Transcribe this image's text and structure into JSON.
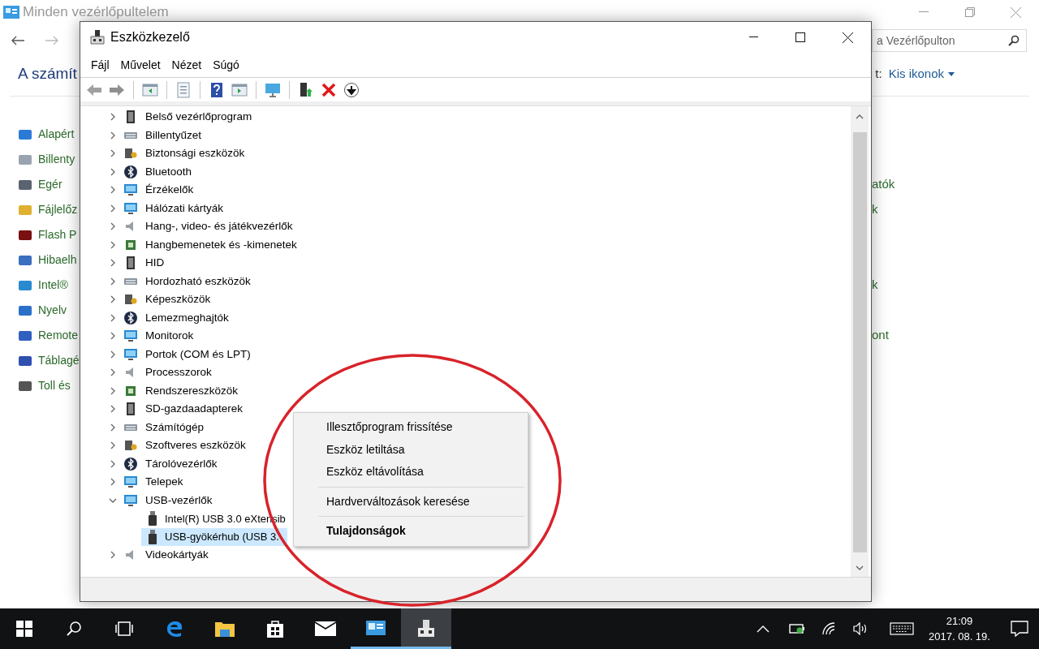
{
  "background_window": {
    "title": "Minden vezérlőpultelem",
    "search": {
      "placeholder": "a Vezérlőpulton"
    },
    "heading": "A számít",
    "view_label": "t:",
    "view_value": "Kis ikonok",
    "rows": [
      {
        "left": "Alapért"
      },
      {
        "left": "Billenty"
      },
      {
        "left": "Egér",
        "right": "atók"
      },
      {
        "left": "Fájlelőz",
        "right": "k"
      },
      {
        "left": "Flash P"
      },
      {
        "left": "Hibaelh"
      },
      {
        "left": "Intel®",
        "right": "k"
      },
      {
        "left": "Nyelv"
      },
      {
        "left": "Remote",
        "right": "ont"
      },
      {
        "left": "Táblagé"
      },
      {
        "left": "Toll és"
      }
    ]
  },
  "window": {
    "title": "Eszközkezelő",
    "menu": [
      "Fájl",
      "Művelet",
      "Nézet",
      "Súgó"
    ],
    "tree": [
      {
        "label": "Belső vezérlőprogram",
        "expanded": false
      },
      {
        "label": "Billentyűzet",
        "expanded": false
      },
      {
        "label": "Biztonsági eszközök",
        "expanded": false
      },
      {
        "label": "Bluetooth",
        "expanded": false
      },
      {
        "label": "Érzékelők",
        "expanded": false
      },
      {
        "label": "Hálózati kártyák",
        "expanded": false
      },
      {
        "label": "Hang-, video- és játékvezérlők",
        "expanded": false
      },
      {
        "label": "Hangbemenetek és -kimenetek",
        "expanded": false
      },
      {
        "label": "HID",
        "expanded": false
      },
      {
        "label": "Hordozható eszközök",
        "expanded": false
      },
      {
        "label": "Képeszközök",
        "expanded": false
      },
      {
        "label": "Lemezmeghajtók",
        "expanded": false
      },
      {
        "label": "Monitorok",
        "expanded": false
      },
      {
        "label": "Portok (COM és LPT)",
        "expanded": false
      },
      {
        "label": "Processzorok",
        "expanded": false
      },
      {
        "label": "Rendszereszközök",
        "expanded": false
      },
      {
        "label": "SD-gazdaadapterek",
        "expanded": false
      },
      {
        "label": "Számítógép",
        "expanded": false
      },
      {
        "label": "Szoftveres eszközök",
        "expanded": false
      },
      {
        "label": "Tárolóvezérlők",
        "expanded": false
      },
      {
        "label": "Telepek",
        "expanded": false
      },
      {
        "label": "USB-vezérlők",
        "expanded": true,
        "children": [
          {
            "label": "Intel(R) USB 3.0 eXtensib",
            "selected": false
          },
          {
            "label": "USB-gyökérhub (USB 3.",
            "selected": true
          }
        ]
      },
      {
        "label": "Videokártyák",
        "expanded": false
      }
    ]
  },
  "context_menu": [
    {
      "kind": "item",
      "label": "Illesztőprogram frissítése",
      "bold": false
    },
    {
      "kind": "item",
      "label": "Eszköz letiltása",
      "bold": false
    },
    {
      "kind": "item",
      "label": "Eszköz eltávolítása",
      "bold": false
    },
    {
      "kind": "separator"
    },
    {
      "kind": "item",
      "label": "Hardverváltozások keresése",
      "bold": false
    },
    {
      "kind": "separator"
    },
    {
      "kind": "item",
      "label": "Tulajdonságok",
      "bold": true
    }
  ],
  "taskbar": {
    "apps": [
      {
        "kind": "start",
        "running": false,
        "selected": false
      },
      {
        "kind": "search",
        "running": false,
        "selected": false
      },
      {
        "kind": "taskview",
        "running": false,
        "selected": false
      },
      {
        "kind": "edge",
        "running": false,
        "selected": false
      },
      {
        "kind": "explorer",
        "running": false,
        "selected": false
      },
      {
        "kind": "store",
        "running": false,
        "selected": false
      },
      {
        "kind": "mail",
        "running": false,
        "selected": false
      },
      {
        "kind": "controlpanel",
        "running": true,
        "selected": false
      },
      {
        "kind": "devicemanager",
        "running": true,
        "selected": true
      }
    ],
    "time": "21:09",
    "date": "2017. 08. 19."
  }
}
